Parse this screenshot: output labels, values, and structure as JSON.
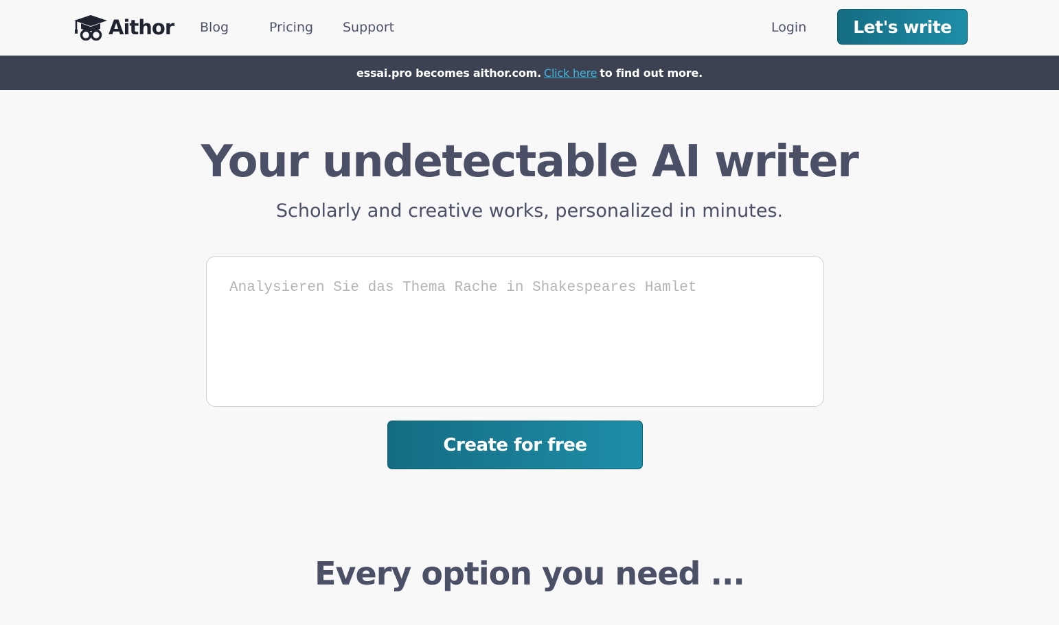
{
  "header": {
    "logo_text": "Aithor",
    "nav": {
      "blog": "Blog",
      "pricing": "Pricing",
      "support": "Support",
      "login": "Login"
    },
    "cta_label": "Let's write",
    "accent_color": "#1a7f98"
  },
  "banner": {
    "prefix": "essai.pro becomes aithor.com.",
    "link_label": "Click here",
    "suffix": "to find out more.",
    "background": "#3d4252",
    "link_color": "#41b5dd"
  },
  "hero": {
    "title": "Your undetectable AI writer",
    "subtitle": "Scholarly and creative works, personalized in minutes.",
    "input_placeholder": "Analysieren Sie das Thema Rache in Shakespeares Hamlet",
    "input_value": "",
    "cta_label": "Create for free"
  },
  "features": {
    "title": "Every option you need ..."
  },
  "icons": {
    "logo": "graduation-cap-glasses-icon"
  }
}
